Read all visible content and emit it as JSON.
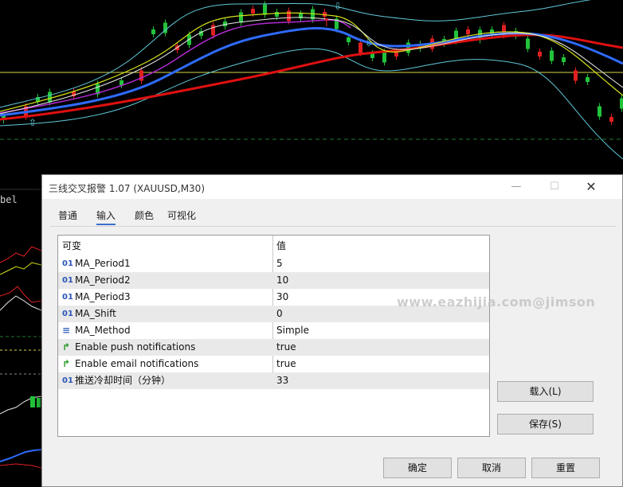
{
  "window": {
    "title": "三线交叉报警 1.07 (XAUUSD,M30)",
    "minimize_glyph": "—",
    "maximize_glyph": "☐",
    "close_glyph": "✕"
  },
  "tabs": [
    "普通",
    "输入",
    "颜色",
    "可视化"
  ],
  "active_tab": "输入",
  "grid": {
    "headers": [
      "可变",
      "值"
    ],
    "rows": [
      {
        "icon": "01",
        "name": "MA_Period1",
        "value": "5"
      },
      {
        "icon": "01",
        "name": "MA_Period2",
        "value": "10"
      },
      {
        "icon": "01",
        "name": "MA_Period3",
        "value": "30"
      },
      {
        "icon": "01",
        "name": "MA_Shift",
        "value": "0"
      },
      {
        "icon": "≡",
        "name": "MA_Method",
        "value": "Simple"
      },
      {
        "icon": "↱",
        "name": "Enable push notifications",
        "value": "true"
      },
      {
        "icon": "↱",
        "name": "Enable email notifications",
        "value": "true"
      },
      {
        "icon": "01",
        "name": "推送冷却时间（分钟）",
        "value": "33"
      }
    ]
  },
  "buttons": {
    "load": "载入(L)",
    "save": "保存(S)",
    "ok": "确定",
    "cancel": "取消",
    "reset": "重置"
  },
  "chart": {
    "left_label": "bel"
  },
  "watermark": "www.eazhijia.com@jimson",
  "colors": {
    "background": "#000000",
    "ma_slow": "#e01010",
    "ma_mid": "#2f6bff",
    "ma_fast": "#d6e21a",
    "bollinger": "#5fc9d9",
    "bull_candle": "#22c33a",
    "bear_candle": "#e02020",
    "level_line": "#d8d84a"
  }
}
